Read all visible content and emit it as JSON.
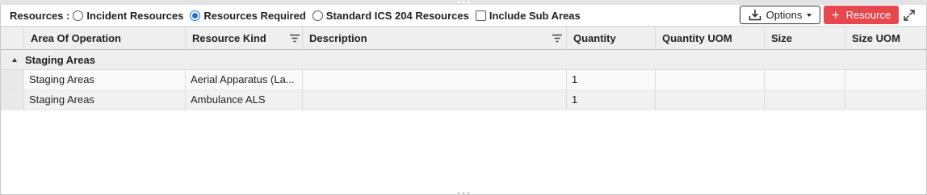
{
  "toolbar": {
    "label": "Resources :",
    "options": [
      {
        "label": "Incident Resources",
        "selected": false
      },
      {
        "label": "Resources Required",
        "selected": true
      },
      {
        "label": "Standard ICS 204 Resources",
        "selected": false
      }
    ],
    "include_sub_areas": {
      "label": "Include Sub Areas",
      "checked": false
    },
    "options_button": "Options",
    "resource_button": "Resource"
  },
  "grid": {
    "columns": [
      "Area Of Operation",
      "Resource Kind",
      "Description",
      "Quantity",
      "Quantity UOM",
      "Size",
      "Size UOM"
    ],
    "group": {
      "label": "Staging Areas"
    },
    "rows": [
      {
        "area": "Staging Areas",
        "kind": "Aerial Apparatus (La...",
        "description": "",
        "quantity": "1",
        "quantity_uom": "",
        "size": "",
        "size_uom": ""
      },
      {
        "area": "Staging Areas",
        "kind": "Ambulance ALS",
        "description": "",
        "quantity": "1",
        "quantity_uom": "",
        "size": "",
        "size_uom": ""
      }
    ]
  },
  "colors": {
    "accent": "#e8484d",
    "radio_selected": "#1a6fd8",
    "header_bg": "#efefef"
  }
}
